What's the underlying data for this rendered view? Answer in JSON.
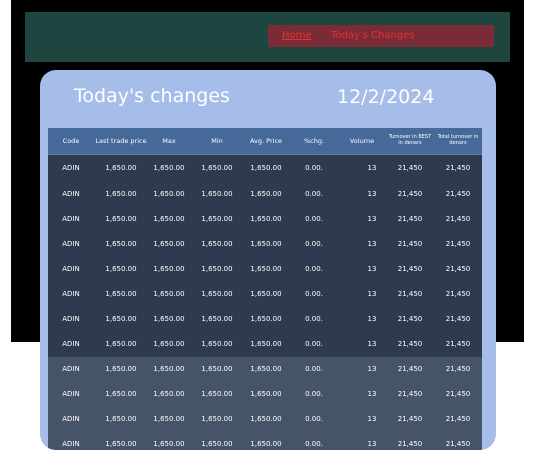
{
  "breadcrumb": {
    "home": "Home",
    "current": "Today's Changes"
  },
  "card": {
    "title": "Today's changes",
    "date": "12/2/2024"
  },
  "table": {
    "headers": [
      "Code",
      "Last trade price",
      "Max",
      "Min",
      "Avg. Price",
      "%chg.",
      "Volume",
      "Turnover in BEST in denars",
      "Total turnover in denars"
    ],
    "rows": [
      [
        "ADIN",
        "1,650.00",
        "1,650.00",
        "1,650.00",
        "1,650.00",
        "0.00.",
        "13",
        "21,450",
        "21,450"
      ],
      [
        "ADIN",
        "1,650.00",
        "1,650.00",
        "1,650.00",
        "1,650.00",
        "0.00.",
        "13",
        "21,450",
        "21,450"
      ],
      [
        "ADIN",
        "1,650.00",
        "1,650.00",
        "1,650.00",
        "1,650.00",
        "0.00.",
        "13",
        "21,450",
        "21,450"
      ],
      [
        "ADIN",
        "1,650.00",
        "1,650.00",
        "1,650.00",
        "1,650.00",
        "0.00.",
        "13",
        "21,450",
        "21,450"
      ],
      [
        "ADIN",
        "1,650.00",
        "1,650.00",
        "1,650.00",
        "1,650.00",
        "0.00.",
        "13",
        "21,450",
        "21,450"
      ],
      [
        "ADIN",
        "1,650.00",
        "1,650.00",
        "1,650.00",
        "1,650.00",
        "0.00.",
        "13",
        "21,450",
        "21,450"
      ],
      [
        "ADIN",
        "1,650.00",
        "1,650.00",
        "1,650.00",
        "1,650.00",
        "0.00.",
        "13",
        "21,450",
        "21,450"
      ],
      [
        "ADIN",
        "1,650.00",
        "1,650.00",
        "1,650.00",
        "1,650.00",
        "0.00.",
        "13",
        "21,450",
        "21,450"
      ],
      [
        "ADIN",
        "1,650.00",
        "1,650.00",
        "1,650.00",
        "1,650.00",
        "0.00.",
        "13",
        "21,450",
        "21,450"
      ],
      [
        "ADIN",
        "1,650.00",
        "1,650.00",
        "1,650.00",
        "1,650.00",
        "0.00.",
        "13",
        "21,450",
        "21,450"
      ],
      [
        "ADIN",
        "1,650.00",
        "1,650.00",
        "1,650.00",
        "1,650.00",
        "0.00.",
        "13",
        "21,450",
        "21,450"
      ],
      [
        "ADIN",
        "1,650.00",
        "1,650.00",
        "1,650.00",
        "1,650.00",
        "0.00.",
        "13",
        "21,450",
        "21,450"
      ]
    ]
  },
  "colors": {
    "header_bar": "#1e4640",
    "breadcrumb_bg": "#7a2b36",
    "breadcrumb_text": "#e23434",
    "card_bg": "#a5bde8",
    "table_header_bg": "#456a99",
    "row_dark": "#2f3a50",
    "row_light": "#465468"
  }
}
